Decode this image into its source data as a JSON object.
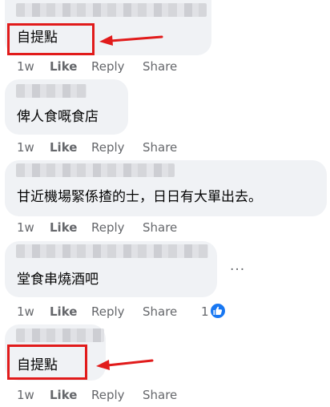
{
  "comments": [
    {
      "text": "自提點",
      "actions": {
        "time": "1w",
        "like": "Like",
        "reply": "Reply",
        "share": "Share"
      }
    },
    {
      "text": "俾人食嘅食店",
      "actions": {
        "time": "1w",
        "like": "Like",
        "reply": "Reply",
        "share": "Share"
      }
    },
    {
      "text": "甘近機場緊係揸的士，日日有大單出去。",
      "actions": {
        "time": "1w",
        "like": "Like",
        "reply": "Reply",
        "share": "Share"
      }
    },
    {
      "text": "堂食串燒酒吧",
      "more": "...",
      "actions": {
        "time": "1w",
        "like": "Like",
        "reply": "Reply",
        "share": "Share",
        "reaction_count": "1"
      }
    },
    {
      "text": "自提點",
      "actions": {
        "time": "1w",
        "like": "Like",
        "reply": "Reply",
        "share": "Share"
      }
    }
  ],
  "colors": {
    "bubble": "#f0f2f5",
    "annotation": "#e11b1b",
    "like_blue": "#1877f2",
    "meta_text": "#65676b"
  }
}
